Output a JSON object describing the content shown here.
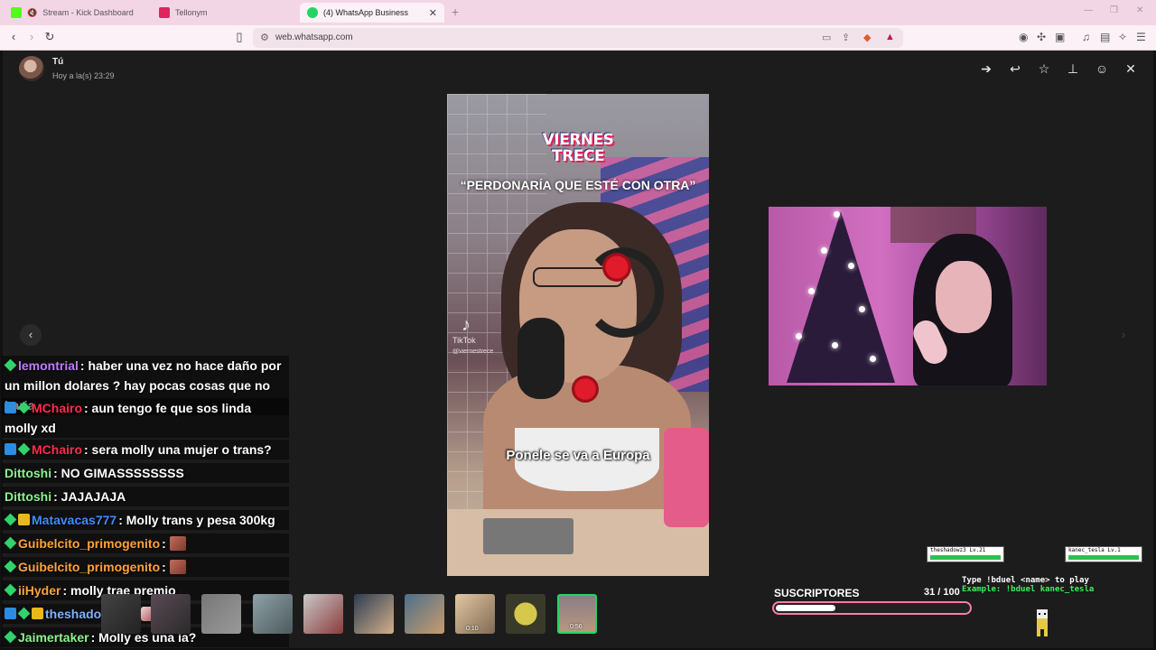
{
  "browser": {
    "tabs": [
      {
        "title": "Stream - Kick Dashboard",
        "color": "#53fc18"
      },
      {
        "title": "Tellonym",
        "color": "#e0245e"
      },
      {
        "title": "(4) WhatsApp Business",
        "color": "#25d366"
      }
    ],
    "url": "web.whatsapp.com"
  },
  "viewer": {
    "sender": "Tú",
    "timestamp": "Hoy a la(s) 23:29",
    "actions": [
      "forward-icon",
      "reply-icon",
      "star-icon",
      "pin-icon",
      "emoji-icon",
      "close-icon"
    ]
  },
  "video": {
    "logo_line1": "VIERNES",
    "logo_line2": "TRECE",
    "quote": "“PERDONARÍA QUE ESTÉ CON OTRA”",
    "tiktok_label": "TikTok",
    "tiktok_user": "@viernestrece",
    "subtitle": "Ponele se va a Europa"
  },
  "chat": {
    "messages": [
      {
        "user": "lemontrial",
        "color": "#c07cff",
        "badges": [
          "diamond"
        ],
        "text": ": haber una vez no hace daño por un millon dolares ? hay pocas cosas que no haria"
      },
      {
        "user": "MChairo",
        "color": "#ff2b4f",
        "badges": [
          "blue",
          "diamond"
        ],
        "text": ": aun tengo fe que sos linda molly xd"
      },
      {
        "user": "MChairo",
        "color": "#ff2b4f",
        "badges": [
          "blue",
          "diamond"
        ],
        "text": ": sera molly una mujer o trans?"
      },
      {
        "user": "Dittoshi",
        "color": "#8cf58f",
        "badges": [],
        "text": ": NO GIMASSSSSSSS"
      },
      {
        "user": "Dittoshi",
        "color": "#8cf58f",
        "badges": [],
        "text": ": JAJAJAJA"
      },
      {
        "user": "Matavacas777",
        "color": "#3f8cff",
        "badges": [
          "diamond",
          "crown"
        ],
        "text": ": Molly trans y pesa 300kg"
      },
      {
        "user": "Guibelcito_primogenito",
        "color": "#ffa33b",
        "badges": [
          "diamond"
        ],
        "text": ":",
        "emote": true
      },
      {
        "user": "Guibelcito_primogenito",
        "color": "#ffa33b",
        "badges": [
          "diamond"
        ],
        "text": ":",
        "emote": true
      },
      {
        "user": "iiHyder",
        "color": "#ffa33b",
        "badges": [
          "diamond"
        ],
        "text": ": molly trae premio"
      },
      {
        "user": "theshadowz37",
        "color": "#7fb2ff",
        "badges": [
          "blue",
          "diamond",
          "crown"
        ],
        "text": ":",
        "emote": true
      },
      {
        "user": "Jaimertaker",
        "color": "#8cf58f",
        "badges": [
          "diamond"
        ],
        "text": ": Molly es una ia?"
      }
    ]
  },
  "thumbnails": [
    {
      "duration": ""
    },
    {
      "duration": ""
    },
    {
      "duration": ""
    },
    {
      "duration": ""
    },
    {
      "duration": ""
    },
    {
      "duration": ""
    },
    {
      "duration": ""
    },
    {
      "duration": ""
    },
    {
      "duration": "0:10"
    },
    {
      "duration": ""
    },
    {
      "duration": "0:56"
    }
  ],
  "subs": {
    "label": "SUSCRIPTORES",
    "count": "31 / 100",
    "progress": 0.31,
    "bar_color": "#ff7aa8"
  },
  "duel": {
    "player1": "theshadowz3 Lv.21",
    "player2": "kanec_tesla Lv.1",
    "help_line1": "Type !bduel <name> to play",
    "help_line2": "Example: !bduel kanec_tesla"
  }
}
